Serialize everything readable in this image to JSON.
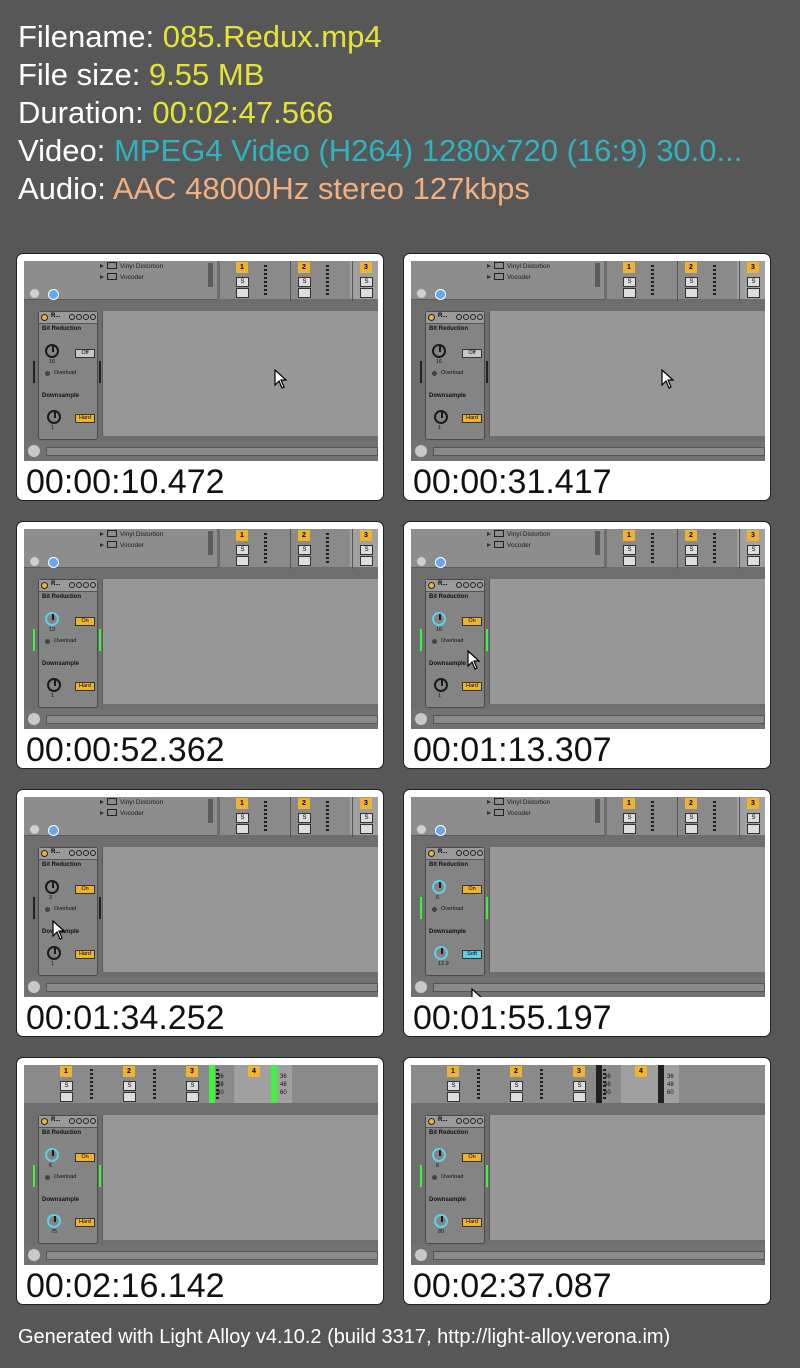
{
  "info": {
    "filename_label": "Filename: ",
    "filename_value": "085.Redux.mp4",
    "filesize_label": "File size: ",
    "filesize_value": "9.55 MB",
    "duration_label": "Duration: ",
    "duration_value": "00:02:47.566",
    "video_label": "Video: ",
    "video_value": "MPEG4 Video (H264) 1280x720 (16:9) 30.0...",
    "audio_label": "Audio: ",
    "audio_value": "AAC 48000Hz stereo 127kbps"
  },
  "colors": {
    "background": "#575757",
    "filename_value": "#e3e33a",
    "video_value": "#2fb3c0",
    "audio_value": "#f2b07e",
    "ableton_yellow": "#f0b330",
    "knob_blue": "#5fd0e6"
  },
  "shared": {
    "browser_items": [
      "Vinyl Distortion",
      "Vocoder"
    ],
    "device_title": "R...",
    "bit_reduction_label": "Bit Reduction",
    "overload_label": "Overload",
    "downsample_label": "Downsample",
    "solo_label": "S"
  },
  "thumbnails": [
    {
      "timestamp": "00:00:10.472",
      "tracks": [
        "1",
        "2",
        "3"
      ],
      "bit_value": "16",
      "bit_toggle": "Off",
      "down_value": "1",
      "down_toggle": "Hard"
    },
    {
      "timestamp": "00:00:31.417",
      "tracks": [
        "1",
        "2",
        "3"
      ],
      "bit_value": "16",
      "bit_toggle": "Off",
      "down_value": "1",
      "down_toggle": "Hard"
    },
    {
      "timestamp": "00:00:52.362",
      "tracks": [
        "1",
        "2",
        "3"
      ],
      "bit_value": "13",
      "bit_toggle": "On",
      "down_value": "1",
      "down_toggle": "Hard"
    },
    {
      "timestamp": "00:01:13.307",
      "tracks": [
        "1",
        "2",
        "3"
      ],
      "bit_value": "16",
      "bit_toggle": "On",
      "down_value": "1",
      "down_toggle": "Hard"
    },
    {
      "timestamp": "00:01:34.252",
      "tracks": [
        "1",
        "2",
        "3"
      ],
      "bit_value": "3",
      "bit_toggle": "On",
      "down_value": "1",
      "down_toggle": "Hard"
    },
    {
      "timestamp": "00:01:55.197",
      "tracks": [
        "1",
        "2",
        "3"
      ],
      "bit_value": "6",
      "bit_toggle": "On",
      "down_value": "12.9",
      "down_toggle": "Soft"
    },
    {
      "timestamp": "00:02:16.142",
      "tracks": [
        "1",
        "2",
        "3",
        "4"
      ],
      "bit_value": "6",
      "bit_toggle": "On",
      "down_value": "75",
      "down_toggle": "Hard",
      "scale": [
        "36",
        "48",
        "60"
      ]
    },
    {
      "timestamp": "00:02:37.087",
      "tracks": [
        "1",
        "2",
        "3",
        "4"
      ],
      "bit_value": "6",
      "bit_toggle": "On",
      "down_value": "80",
      "down_toggle": "Hard",
      "scale": [
        "36",
        "48",
        "60"
      ]
    }
  ],
  "footer": "Generated with Light Alloy v4.10.2 (build 3317, http://light-alloy.verona.im)"
}
